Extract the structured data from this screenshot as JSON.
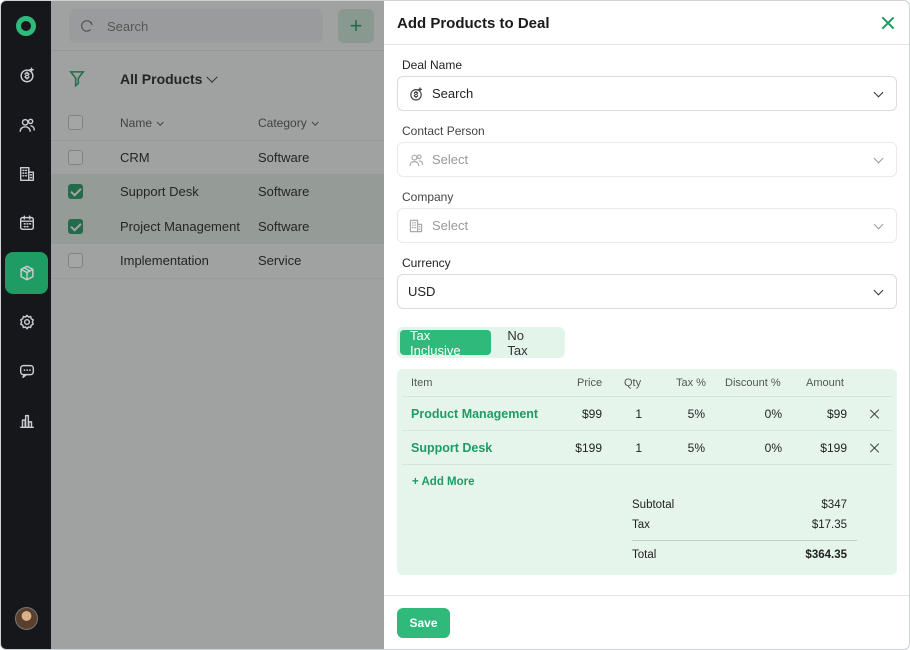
{
  "background": {
    "search_placeholder": "Search",
    "add_label": "+",
    "list_title": "All Products",
    "columns": {
      "name": "Name",
      "category": "Category"
    },
    "rows": [
      {
        "name": "CRM",
        "category": "Software",
        "checked": false
      },
      {
        "name": "Support Desk",
        "category": "Software",
        "checked": true
      },
      {
        "name": "Project Management",
        "category": "Software",
        "checked": true
      },
      {
        "name": "Implementation",
        "category": "Service",
        "checked": false
      }
    ]
  },
  "sidebar": {
    "items": [
      {
        "icon": "deals-icon"
      },
      {
        "icon": "contacts-icon"
      },
      {
        "icon": "company-icon"
      },
      {
        "icon": "calendar-icon"
      },
      {
        "icon": "products-icon",
        "active": true
      },
      {
        "icon": "settings-icon"
      },
      {
        "icon": "chat-icon"
      },
      {
        "icon": "reports-icon"
      }
    ]
  },
  "modal": {
    "title": "Add Products to Deal",
    "deal_name": {
      "label": "Deal Name",
      "placeholder": "Search"
    },
    "contact_person": {
      "label": "Contact Person",
      "placeholder": "Select"
    },
    "company": {
      "label": "Company",
      "placeholder": "Select"
    },
    "currency": {
      "label": "Currency",
      "value": "USD"
    },
    "tax_options": [
      "Tax Inclusive",
      "No Tax"
    ],
    "tax_selected": "Tax Inclusive",
    "items_columns": {
      "item": "Item",
      "price": "Price",
      "qty": "Qty",
      "tax": "Tax %",
      "discount": "Discount %",
      "amount": "Amount"
    },
    "items": [
      {
        "item": "Product Management",
        "price": "$99",
        "qty": "1",
        "tax": "5%",
        "discount": "0%",
        "amount": "$99"
      },
      {
        "item": "Support Desk",
        "price": "$199",
        "qty": "1",
        "tax": "5%",
        "discount": "0%",
        "amount": "$199"
      }
    ],
    "add_more": "+ Add More",
    "subtotal_label": "Subtotal",
    "subtotal": "$347",
    "tax_label": "Tax",
    "tax": "$17.35",
    "total_label": "Total",
    "total": "$364.35",
    "save_label": "Save"
  },
  "colors": {
    "accent": "#2fb97a",
    "accent_dark": "#1f9c63",
    "sidebar": "#15171b"
  }
}
